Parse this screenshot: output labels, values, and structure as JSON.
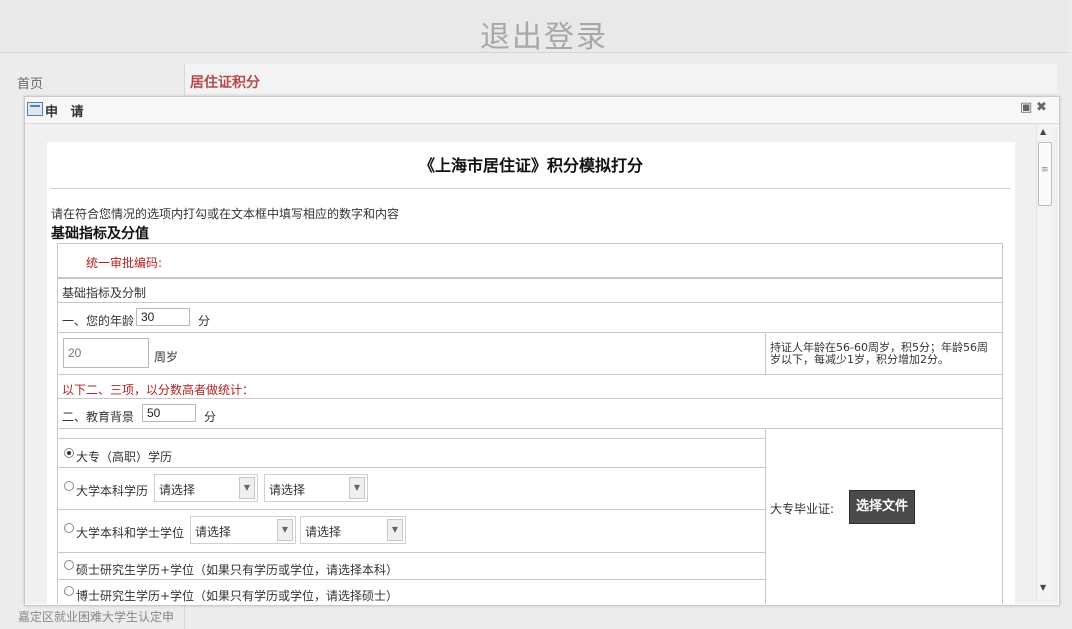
{
  "header": {
    "logout": "退出登录"
  },
  "nav": {
    "home": "首页",
    "residence": "居住证积分",
    "bottom_link": "嘉定区就业困难大学生认定申"
  },
  "dialog": {
    "title": "申 请"
  },
  "form": {
    "title": "《上海市居住证》积分模拟打分",
    "instructions": "请在符合您情况的选项内打勾或在文本框中填写相应的数字和内容",
    "section_heading": "基础指标及分值",
    "approval_label": "统一审批编码:",
    "basic_header": "基础指标及分制",
    "age_label": "一、您的年龄",
    "age_value": "30",
    "age_unit": "分",
    "age_years_placeholder": "20",
    "age_years_unit": "周岁",
    "age_note": "持证人年龄在56-60周岁，积5分；年龄56周岁以下，每减少1岁，积分增加2分。",
    "note_highest": "以下二、三项，以分数高者做统计：",
    "edu_label": "二、教育背景",
    "edu_value": "50",
    "edu_unit": "分",
    "options": [
      {
        "label": "大专（高职）学历",
        "checked": true
      },
      {
        "label": "大学本科学历",
        "checked": false
      },
      {
        "label": "大学本科和学士学位",
        "checked": false
      },
      {
        "label": "硕士研究生学历+学位（如果只有学历或学位，请选择本科）",
        "checked": false
      },
      {
        "label": "博士研究生学历+学位（如果只有学历或学位，请选择硕士）",
        "checked": false
      }
    ],
    "select_placeholder": "请选择",
    "diploma_label": "大专毕业证:",
    "file_button": "选择文件"
  }
}
